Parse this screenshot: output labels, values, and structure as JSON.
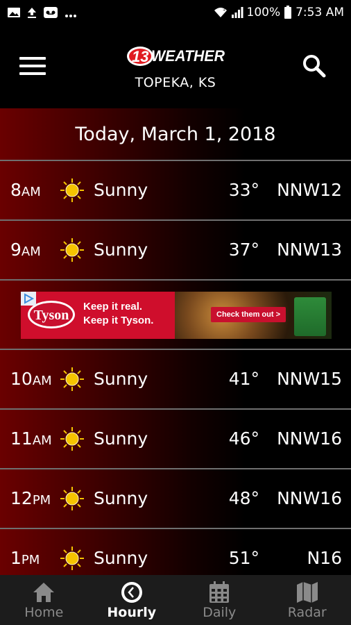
{
  "status_bar": {
    "battery": "100%",
    "time": "7:53 AM",
    "icons": [
      "image-icon",
      "upload-icon",
      "voicemail-icon",
      "more-dots-icon",
      "wifi-icon",
      "signal-icon",
      "battery-icon"
    ]
  },
  "header": {
    "logo_number": "13",
    "logo_text": "WEATHER",
    "location": "TOPEKA, KS",
    "icons": [
      "menu-icon",
      "search-icon"
    ]
  },
  "forecast": {
    "date": "Today, March 1, 2018",
    "hours": [
      {
        "hour": "8",
        "period": "AM",
        "icon": "sun-icon",
        "condition": "Sunny",
        "temp": "33°",
        "wind": "NNW12"
      },
      {
        "hour": "9",
        "period": "AM",
        "icon": "sun-icon",
        "condition": "Sunny",
        "temp": "37°",
        "wind": "NNW13"
      },
      {
        "hour": "10",
        "period": "AM",
        "icon": "sun-icon",
        "condition": "Sunny",
        "temp": "41°",
        "wind": "NNW15"
      },
      {
        "hour": "11",
        "period": "AM",
        "icon": "sun-icon",
        "condition": "Sunny",
        "temp": "46°",
        "wind": "NNW16"
      },
      {
        "hour": "12",
        "period": "PM",
        "icon": "sun-icon",
        "condition": "Sunny",
        "temp": "48°",
        "wind": "NNW16"
      },
      {
        "hour": "1",
        "period": "PM",
        "icon": "sun-icon",
        "condition": "Sunny",
        "temp": "51°",
        "wind": "N16"
      }
    ]
  },
  "ad": {
    "brand": "Tyson",
    "line1": "Keep it real.",
    "line2": "Keep it Tyson.",
    "cta": "Check them out >"
  },
  "bottom_nav": [
    {
      "label": "Home",
      "icon": "home-icon",
      "active": false
    },
    {
      "label": "Hourly",
      "icon": "clock-icon",
      "active": true
    },
    {
      "label": "Daily",
      "icon": "calendar-icon",
      "active": false
    },
    {
      "label": "Radar",
      "icon": "map-icon",
      "active": false
    }
  ],
  "colors": {
    "gradient_red": "#6a0000",
    "divider": "#6f6f6f",
    "sun": "#f5c400",
    "nav_bg": "#1c1c1c",
    "nav_inactive": "#8a8a8a",
    "brand_red": "#c8102e"
  }
}
